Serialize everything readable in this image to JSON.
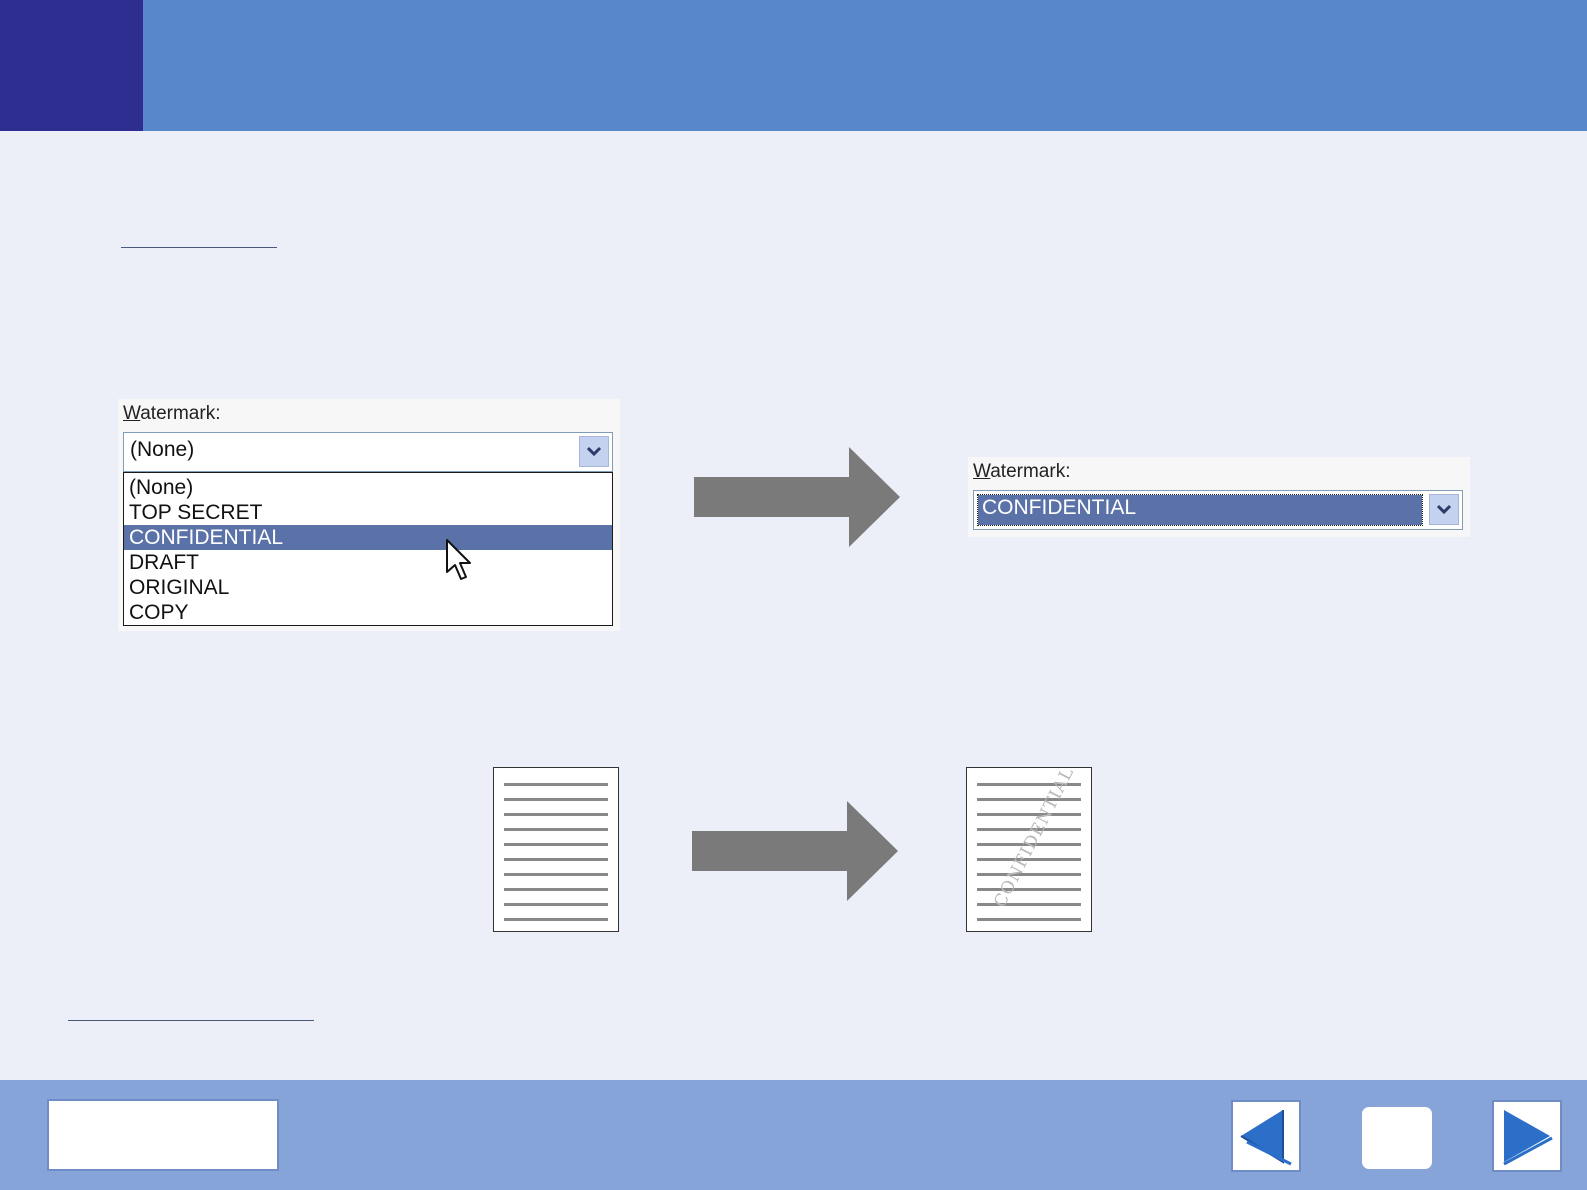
{
  "watermark_dropdown": {
    "label": "Watermark:",
    "label_accel": "W",
    "label_rest": "atermark:",
    "current_value": "(None)",
    "options": [
      "(None)",
      "TOP SECRET",
      "CONFIDENTIAL",
      "DRAFT",
      "ORIGINAL",
      "COPY"
    ],
    "highlighted_option": "CONFIDENTIAL"
  },
  "watermark_result": {
    "label_accel": "W",
    "label_rest": "atermark:",
    "selected_value": "CONFIDENTIAL"
  },
  "preview": {
    "watermark_text": "CONFIDENTIAL"
  },
  "colors": {
    "header": "#5887cb",
    "header_block": "#2e2e90",
    "background": "#edeff8",
    "footer": "#87a4d9",
    "selection": "#5b72a8",
    "arrow": "#7a7a7a",
    "nav_arrow": "#2b6fc9"
  }
}
